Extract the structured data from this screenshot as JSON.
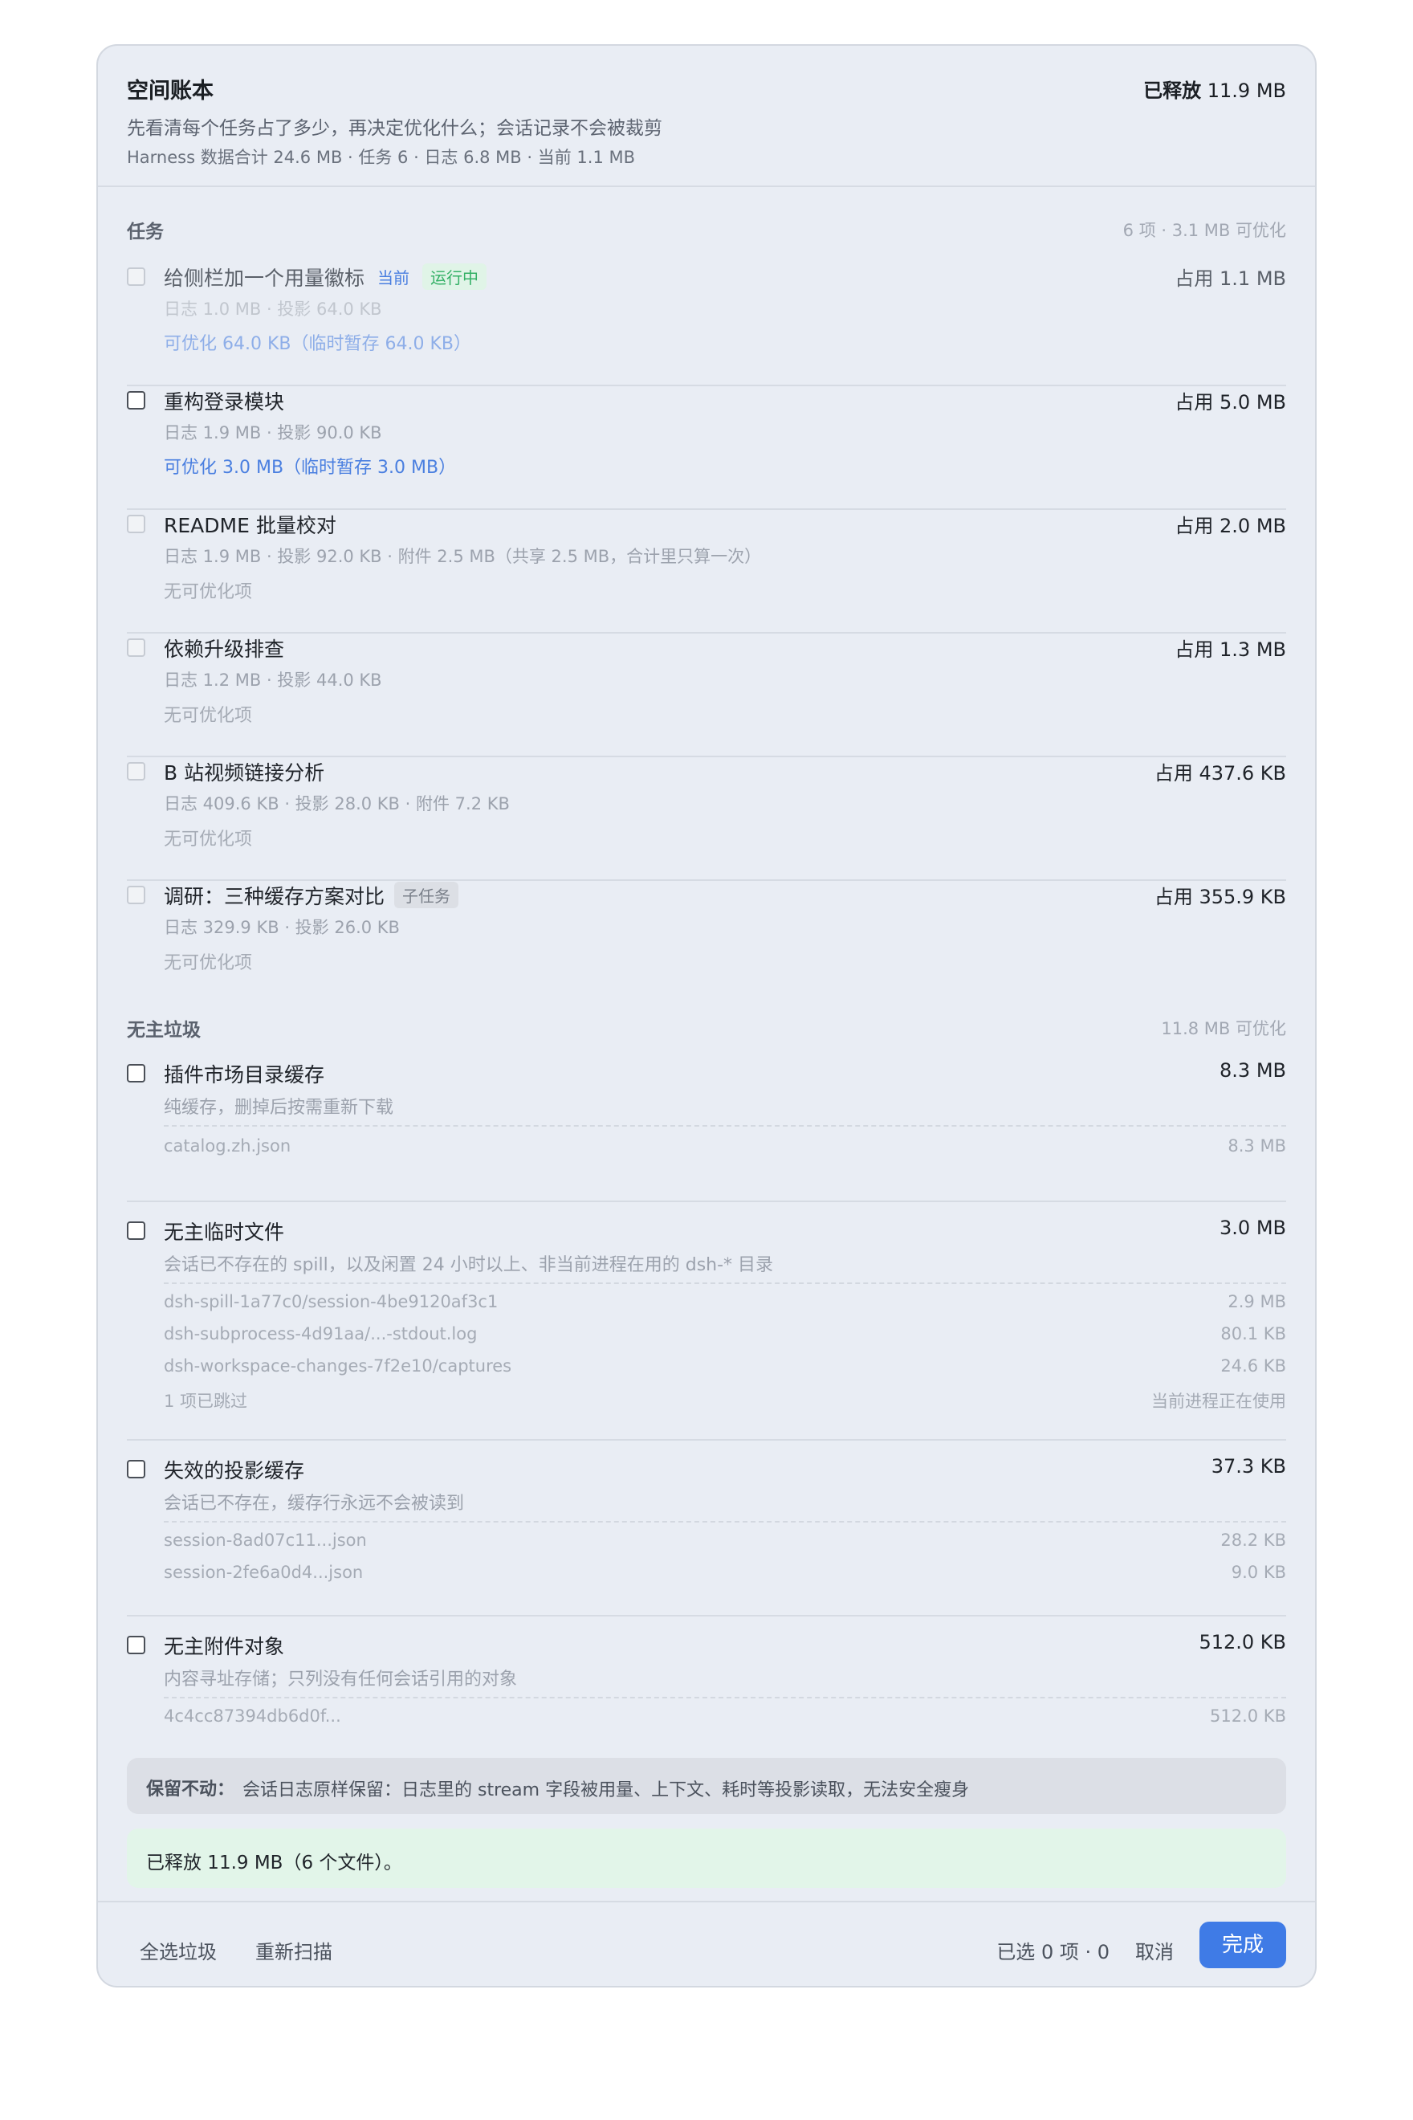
{
  "header": {
    "title": "空间账本",
    "released_label": "已释放",
    "released_value": "11.9 MB",
    "subtitle": "先看清每个任务占了多少，再决定优化什么；会话记录不会被裁剪",
    "stats": "Harness 数据合计 24.6 MB · 任务 6 · 日志 6.8 MB · 当前 1.1 MB"
  },
  "tasks_section": {
    "title": "任务",
    "summary": "6 项 · 3.1 MB 可优化",
    "items": [
      {
        "name": "给侧栏加一个用量徽标",
        "badge_current": "当前",
        "badge_status": "运行中",
        "occupy": "占用 1.1 MB",
        "meta": "日志 1.0 MB · 投影 64.0 KB",
        "note": "可优化 64.0 KB（临时暂存 64.0 KB）",
        "checkbox_state": "disabled"
      },
      {
        "name": "重构登录模块",
        "occupy": "占用 5.0 MB",
        "meta": "日志 1.9 MB · 投影 90.0 KB",
        "note": "可优化 3.0 MB（临时暂存 3.0 MB）",
        "checkbox_state": "enabled"
      },
      {
        "name": "README 批量校对",
        "occupy": "占用 2.0 MB",
        "meta": "日志 1.9 MB · 投影 92.0 KB · 附件 2.5 MB（共享 2.5 MB，合计里只算一次）",
        "note": "无可优化项",
        "checkbox_state": "disabled"
      },
      {
        "name": "依赖升级排查",
        "occupy": "占用 1.3 MB",
        "meta": "日志 1.2 MB · 投影 44.0 KB",
        "note": "无可优化项",
        "checkbox_state": "disabled"
      },
      {
        "name": "B 站视频链接分析",
        "occupy": "占用 437.6 KB",
        "meta": "日志 409.6 KB · 投影 28.0 KB · 附件 7.2 KB",
        "note": "无可优化项",
        "checkbox_state": "disabled"
      },
      {
        "name": "调研：三种缓存方案对比",
        "badge_sub": "子任务",
        "occupy": "占用 355.9 KB",
        "meta": "日志 329.9 KB · 投影 26.0 KB",
        "note": "无可优化项",
        "checkbox_state": "disabled"
      }
    ]
  },
  "orphan_section": {
    "title": "无主垃圾",
    "summary": "11.8 MB 可优化",
    "groups": [
      {
        "name": "插件市场目录缓存",
        "size": "8.3 MB",
        "desc": "纯缓存，删掉后按需重新下载",
        "files": [
          {
            "name": "catalog.zh.json",
            "size": "8.3 MB"
          }
        ]
      },
      {
        "name": "无主临时文件",
        "size": "3.0 MB",
        "desc": "会话已不存在的 spill，以及闲置 24 小时以上、非当前进程在用的 dsh-* 目录",
        "files": [
          {
            "name": "dsh-spill-1a77c0/session-4be9120af3c1",
            "size": "2.9 MB"
          },
          {
            "name": "dsh-subprocess-4d91aa/...-stdout.log",
            "size": "80.1 KB"
          },
          {
            "name": "dsh-workspace-changes-7f2e10/captures",
            "size": "24.6 KB"
          },
          {
            "name": "1 项已跳过",
            "size": "当前进程正在使用"
          }
        ]
      },
      {
        "name": "失效的投影缓存",
        "size": "37.3 KB",
        "desc": "会话已不存在，缓存行永远不会被读到",
        "files": [
          {
            "name": "session-8ad07c11...json",
            "size": "28.2 KB"
          },
          {
            "name": "session-2fe6a0d4...json",
            "size": "9.0 KB"
          }
        ]
      },
      {
        "name": "无主附件对象",
        "size": "512.0 KB",
        "desc": "内容寻址存储；只列没有任何会话引用的对象",
        "files": [
          {
            "name": "4c4cc87394db6d0f...",
            "size": "512.0 KB"
          }
        ]
      }
    ]
  },
  "keep_notice": {
    "label": "保留不动：",
    "text": "会话日志原样保留：日志里的 stream 字段被用量、上下文、耗时等投影读取，无法安全瘦身"
  },
  "result_message": "已释放 11.9 MB（6 个文件）。",
  "footer": {
    "select_all_junk": "全选垃圾",
    "rescan": "重新扫描",
    "selection_status": "已选 0 项 · 0",
    "cancel": "取消",
    "done": "完成"
  },
  "colors": {
    "accent": "#3f7be6",
    "running_green": "#33b065",
    "success_bg": "#e2f5e9",
    "panel_bg": "#e9edf4"
  }
}
